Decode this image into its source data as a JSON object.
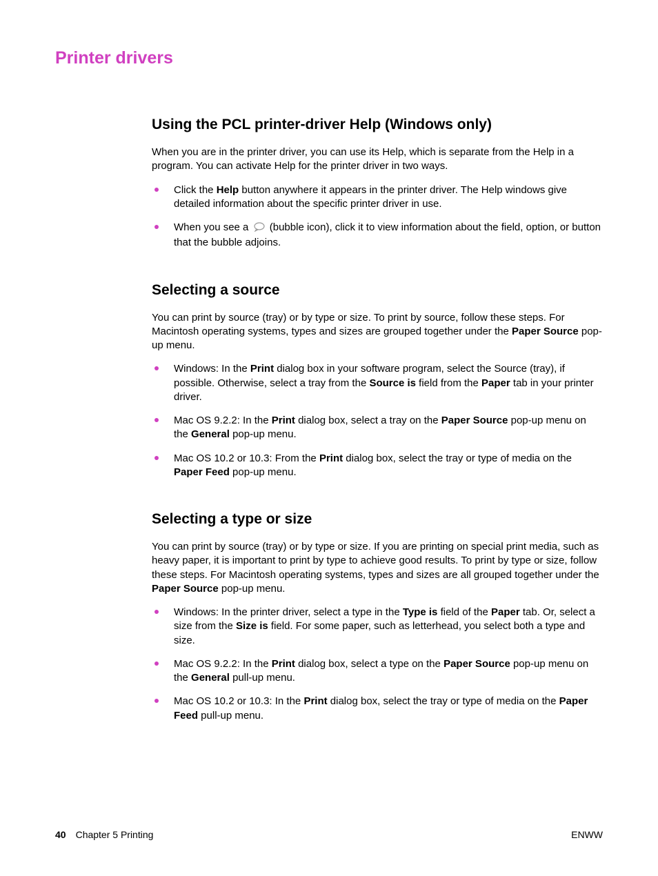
{
  "title": "Printer drivers",
  "sections": [
    {
      "heading": "Using the PCL printer-driver Help (Windows only)",
      "intro": "When you are in the printer driver, you can use its Help, which is separate from the Help in a program. You can activate Help for the printer driver in two ways.",
      "bullets": [
        {
          "pre": "Click the ",
          "b1": "Help",
          "post": " button anywhere it appears in the printer driver. The Help windows give detailed information about the specific printer driver in use."
        },
        {
          "pre": "When you see a ",
          "iconLabel": "bubble icon",
          "post": " (bubble icon), click it to view information about the field, option, or button that the bubble adjoins."
        }
      ]
    },
    {
      "heading": "Selecting a source",
      "intro_parts": {
        "p1": "You can print by source (tray) or by type or size. To print by source, follow these steps. For Macintosh operating systems, types and sizes are grouped together under the ",
        "b1": "Paper Source",
        "p2": " pop-up menu."
      },
      "bullets": [
        {
          "t": "Windows: In the ",
          "b1": "Print",
          "t2": " dialog box in your software program, select the Source (tray), if possible. Otherwise, select a tray from the ",
          "b2": "Source is",
          "t3": " field from the ",
          "b3": "Paper",
          "t4": " tab in your printer driver."
        },
        {
          "t": "Mac OS 9.2.2: In the ",
          "b1": "Print",
          "t2": " dialog box, select a tray on the ",
          "b2": "Paper Source",
          "t3": " pop-up menu on the ",
          "b3": "General",
          "t4": " pop-up menu."
        },
        {
          "t": "Mac OS 10.2 or 10.3: From the ",
          "b1": "Print",
          "t2": " dialog box, select the tray or type of media on the ",
          "b2": "Paper Feed",
          "t3": " pop-up menu."
        }
      ]
    },
    {
      "heading": "Selecting a type or size",
      "intro_parts": {
        "p1": "You can print by source (tray) or by type or size. If you are printing on special print media, such as heavy paper, it is important to print by type to achieve good results. To print by type or size, follow these steps. For Macintosh operating systems, types and sizes are all grouped together under the ",
        "b1": "Paper Source",
        "p2": " pop-up menu."
      },
      "bullets": [
        {
          "t": "Windows: In the printer driver, select a type in the ",
          "b1": "Type is",
          "t2": " field of the ",
          "b2": "Paper",
          "t3": " tab. Or, select a size from the ",
          "b3": "Size is",
          "t4": " field. For some paper, such as letterhead, you select both a type and size."
        },
        {
          "t": "Mac OS 9.2.2: In the ",
          "b1": "Print",
          "t2": " dialog box, select a type on the ",
          "b2": "Paper Source",
          "t3": " pop-up menu on the ",
          "b3": "General",
          "t4": " pull-up menu."
        },
        {
          "t": "Mac OS 10.2 or 10.3: In the ",
          "b1": "Print",
          "t2": " dialog box, select the tray or type of media on the ",
          "b2": "Paper Feed",
          "t3": " pull-up menu."
        }
      ]
    }
  ],
  "footer": {
    "pageNum": "40",
    "chapter": "Chapter 5  Printing",
    "right": "ENWW"
  }
}
